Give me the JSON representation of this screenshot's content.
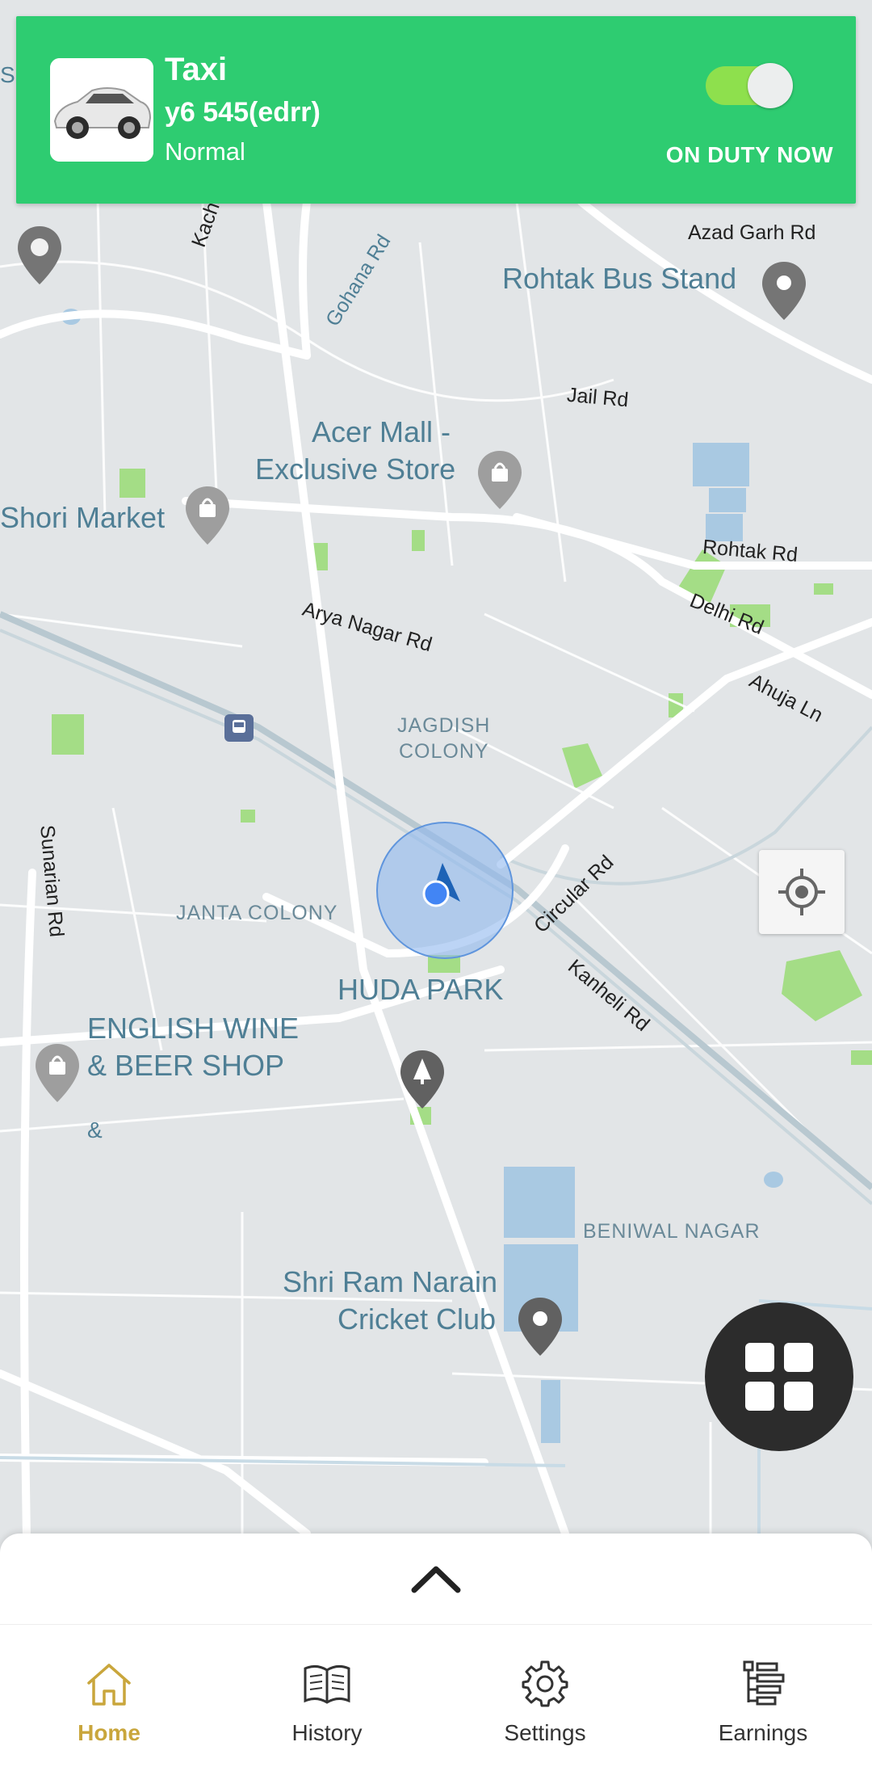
{
  "header": {
    "vehicle_type": "Taxi",
    "plate": "y6 545(edrr)",
    "class": "Normal",
    "duty_status": "ON DUTY NOW",
    "toggle_on": true,
    "accent_color": "#2ecc71"
  },
  "map": {
    "roads": {
      "kacha": "Kacha C",
      "gohana": "Gohana Rd",
      "azad": "Azad Garh Rd",
      "jail": "Jail Rd",
      "rohtak": "Rohtak Rd",
      "delhi": "Delhi Rd",
      "arya": "Arya Nagar Rd",
      "ahuja": "Ahuja Ln",
      "circular": "Circular Rd",
      "kanheli": "Kanheli Rd",
      "sunarian": "Sunarian Rd"
    },
    "places": {
      "bus_stand": "Rohtak Bus Stand",
      "acer_line1": "Acer Mall -",
      "acer_line2": "Exclusive Store",
      "shori": "Shori Market",
      "huda": "HUDA PARK",
      "wine_line1": "ENGLISH WINE",
      "wine_line2": "& BEER SHOP",
      "amp": "&",
      "cricket_line1": "Shri Ram Narain",
      "cricket_line2": "Cricket Club",
      "edge_s": "S"
    },
    "areas": {
      "jagdish_line1": "JAGDISH",
      "jagdish_line2": "COLONY",
      "janta": "JANTA COLONY",
      "beniwal": "BENIWAL NAGAR"
    }
  },
  "icons": {
    "locate": "my-location-icon",
    "menu": "grid-menu-icon",
    "expand": "chevron-up-icon"
  },
  "nav": {
    "items": [
      {
        "label": "Home",
        "icon": "home-icon",
        "active": true
      },
      {
        "label": "History",
        "icon": "book-icon",
        "active": false
      },
      {
        "label": "Settings",
        "icon": "gear-icon",
        "active": false
      },
      {
        "label": "Earnings",
        "icon": "list-icon",
        "active": false
      }
    ],
    "active_color": "#c9a63c"
  }
}
